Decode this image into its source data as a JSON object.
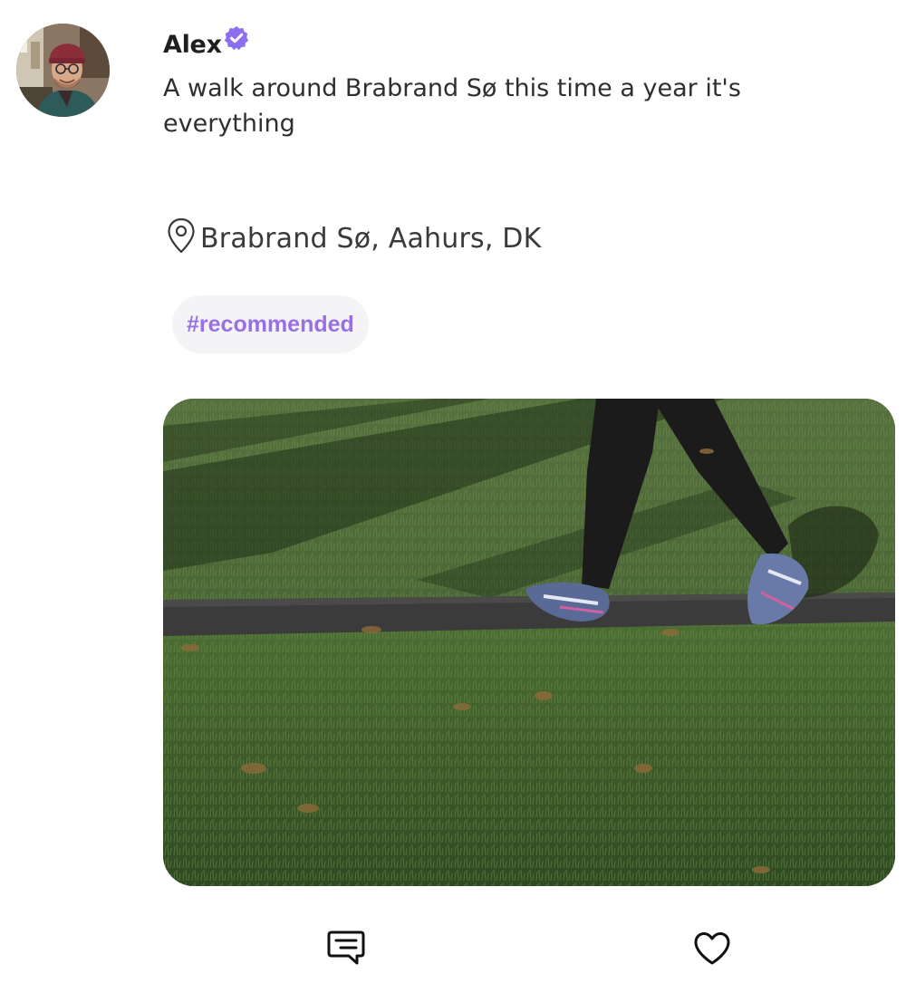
{
  "post": {
    "author": {
      "name": "Alex",
      "verified": true,
      "avatar": "avatar"
    },
    "text": "A walk around Brabrand Sø this time a year it's everything",
    "location": {
      "icon": "location-pin-icon",
      "text": "Brabrand Sø, Aahurs, DK"
    },
    "tags": [
      "#recommended"
    ],
    "image": "post-image"
  },
  "actions": {
    "comment_icon": "comment-icon",
    "like_icon": "heart-icon"
  },
  "colors": {
    "accent": "#9a6fe6",
    "verified_badge": "#8b6ff0",
    "tag_background": "#f4f4f6",
    "text": "#2f2f2f"
  }
}
